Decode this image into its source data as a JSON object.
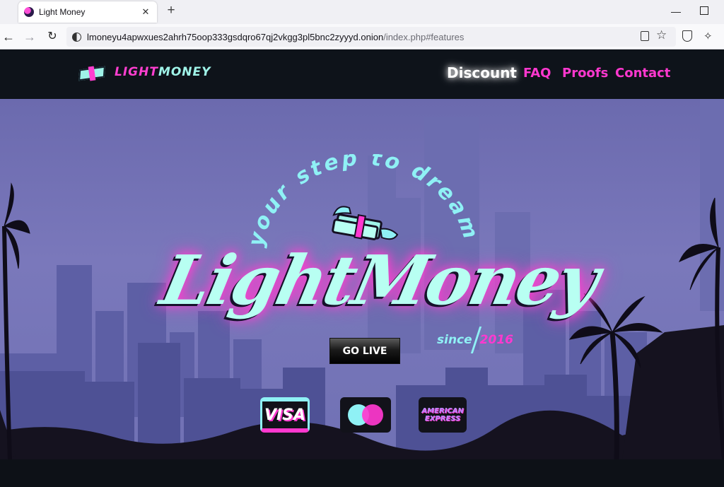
{
  "browser": {
    "tab": {
      "title": "Light Money",
      "favicon": "light-money-favicon",
      "close_glyph": "✕"
    },
    "new_tab_glyph": "+",
    "window": {
      "minimize_glyph": "—"
    },
    "nav": {
      "back_glyph": "←",
      "forward_glyph": "→",
      "reload_glyph": "↻"
    },
    "url": {
      "host": "lmoneyu4apwxues2ahrh75oop333gsdqro67qj2vkgg3pl5bnc2zyyyd.onion",
      "path": "/index.php#features"
    },
    "toolbar_icons": [
      "reader-view-icon",
      "bookmark-star-icon",
      "shield-icon",
      "extensions-icon"
    ]
  },
  "site": {
    "logo": {
      "part1": "LIGHT",
      "part2": "MONEY"
    },
    "nav": [
      {
        "label": "Discount",
        "active": true
      },
      {
        "label": "FAQ",
        "active": false
      },
      {
        "label": "Proofs",
        "active": false
      },
      {
        "label": "Contact",
        "active": false
      }
    ],
    "hero": {
      "tagline": "your step to dream",
      "title": "LightMoney",
      "since_label": "since",
      "since_year": "2016",
      "cta": "GO LIVE",
      "payments": {
        "visa": "VISA",
        "mastercard": "mastercard-logo",
        "amex_line1": "AMERICAN",
        "amex_line2": "EXPRESS"
      }
    },
    "colors": {
      "accent_pink": "#ff38cf",
      "accent_cyan": "#8ff1f5",
      "header_bg": "#0e131a",
      "sky": "#7a78bb"
    }
  }
}
